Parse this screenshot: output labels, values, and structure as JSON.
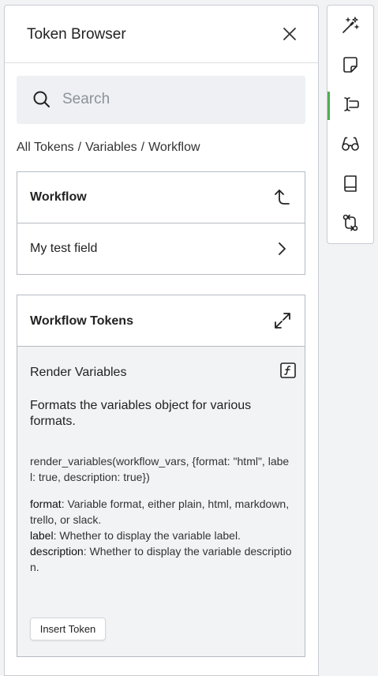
{
  "panel": {
    "title": "Token Browser"
  },
  "search": {
    "placeholder": "Search"
  },
  "breadcrumb": [
    "All Tokens",
    "Variables",
    "Workflow"
  ],
  "nav": {
    "current": "Workflow",
    "items": [
      {
        "label": "My test field"
      }
    ]
  },
  "tokens": {
    "header": "Workflow Tokens",
    "token": {
      "name": "Render Variables",
      "description": "Formats the variables object for various formats.",
      "signature": "render_variables(workflow_vars, {format: \"html\", label: true, description: true})",
      "params": [
        {
          "name": "format",
          "text": ": Variable format, either plain, html, markdown, trello, or slack."
        },
        {
          "name": "label",
          "text": ": Whether to display the variable label."
        },
        {
          "name": "description",
          "text": ": Whether to display the variable description."
        }
      ]
    },
    "insert_label": "Insert Token"
  },
  "toolbar": {
    "items": [
      {
        "icon": "magic-wand-icon"
      },
      {
        "icon": "document-icon"
      },
      {
        "icon": "text-cursor-icon",
        "active": true
      },
      {
        "icon": "glasses-icon"
      },
      {
        "icon": "book-icon"
      },
      {
        "icon": "git-compare-icon"
      }
    ],
    "active_color": "#4caf50"
  }
}
